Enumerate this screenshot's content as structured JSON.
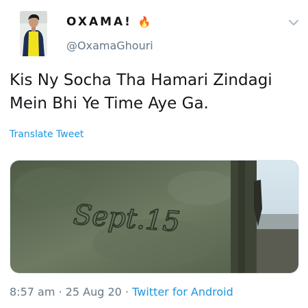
{
  "author": {
    "display_name": "OXAMA!",
    "emoji": "🔥",
    "handle": "@OxamaGhouri",
    "avatar_icon": "profile-photo"
  },
  "menu_icon": "chevron-down-icon",
  "tweet": {
    "line1": "Kis Ny Socha Tha Hamari Zindagi",
    "line2": "Mein Bhi Ye Time Aye Ga.",
    "translate_label": "Translate Tweet"
  },
  "media": {
    "carved_text": "Sept.15"
  },
  "meta": {
    "time": "8:57 am",
    "separator": "·",
    "date": "25 Aug 20",
    "source": "Twitter for Android"
  },
  "colors": {
    "link": "#1b95e0",
    "muted": "#657786",
    "text": "#14171a"
  }
}
